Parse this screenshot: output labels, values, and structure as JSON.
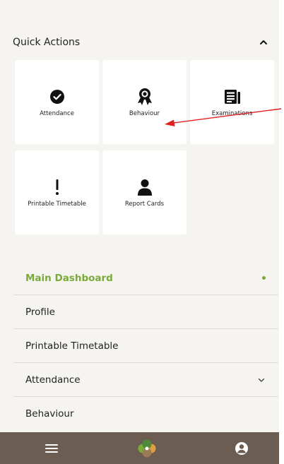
{
  "quick_actions": {
    "title": "Quick Actions",
    "toggle_icon": "chevron-up-icon",
    "tiles": [
      {
        "label": "Attendance",
        "icon": "check-circle-icon"
      },
      {
        "label": "Behaviour",
        "icon": "award-ribbon-icon"
      },
      {
        "label": "Examinations",
        "icon": "newspaper-icon"
      },
      {
        "label": "Printable Timetable",
        "icon": "exclamation-icon"
      },
      {
        "label": "Report Cards",
        "icon": "person-icon"
      }
    ]
  },
  "menu": {
    "items": [
      {
        "label": "Main Dashboard",
        "active": true,
        "indicator": "active-dot"
      },
      {
        "label": "Profile"
      },
      {
        "label": "Printable Timetable"
      },
      {
        "label": "Attendance",
        "indicator": "chevron-down-icon"
      },
      {
        "label": "Behaviour"
      }
    ]
  },
  "bottom_bar": {
    "icons": [
      "hamburger-menu-icon",
      "school-logo-icon",
      "user-account-icon"
    ],
    "background": "#6b5d52"
  },
  "colors": {
    "accent": "#7aaa3a",
    "page_background": "#f5f4f0",
    "annotation_arrow": "#e02020"
  }
}
